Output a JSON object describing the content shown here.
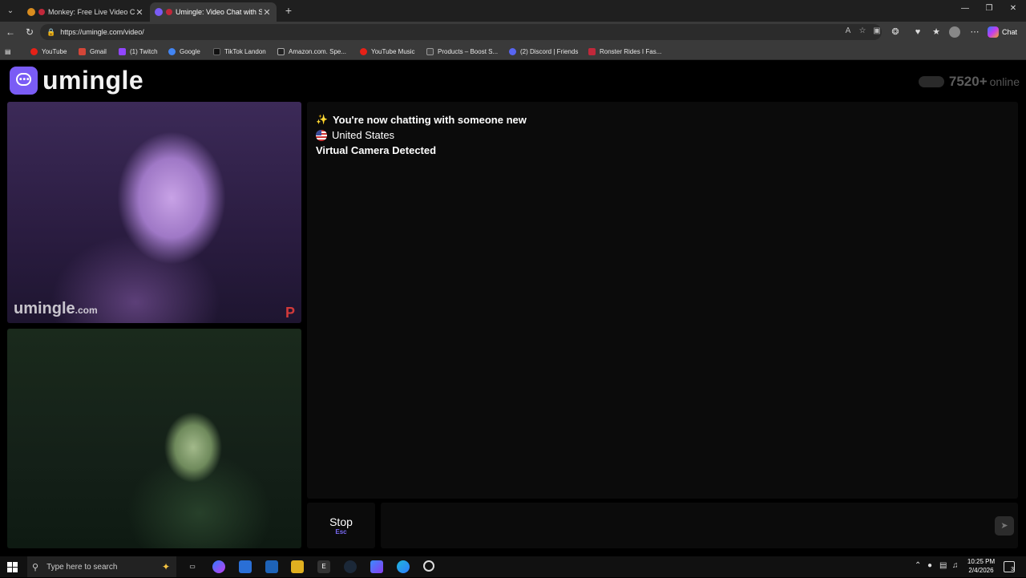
{
  "browser": {
    "tabs": [
      {
        "label": "Monkey: Free Live Video Chat",
        "active": false,
        "favicon_color": "#d98c1f"
      },
      {
        "label": "Umingle: Video Chat with Stra",
        "active": true,
        "favicon_color": "#7a5cf5"
      }
    ],
    "new_tab": "+",
    "url": "https://umingle.com/video/",
    "chat_label": "Chat",
    "bookmarks": [
      {
        "label": "YouTube",
        "icon_color": "#e62117"
      },
      {
        "label": "Gmail",
        "icon_color": "#d44638"
      },
      {
        "label": "(1) Twitch",
        "icon_color": "#9146ff"
      },
      {
        "label": "Google",
        "icon_color": "#4285f4"
      },
      {
        "label": "TikTok Landon",
        "icon_color": "#111111"
      },
      {
        "label": "Amazon.com. Spe...",
        "icon_color": "#222222"
      },
      {
        "label": "YouTube Music",
        "icon_color": "#e62117"
      },
      {
        "label": "Products – Boost S...",
        "icon_color": "#444444"
      },
      {
        "label": "(2) Discord | Friends",
        "icon_color": "#5865f2"
      },
      {
        "label": "Ronster Rides I Fas...",
        "icon_color": "#c0283a"
      }
    ]
  },
  "site": {
    "brand": "umingle",
    "brand_color": "#7a5cf5",
    "online_count": "7520+",
    "online_label": "online",
    "stranger_watermark": "umingle",
    "stranger_watermark_suffix": ".com",
    "stranger_badge": "P"
  },
  "chat": {
    "messages": [
      {
        "icon": "sparkles-icon",
        "text": "You're now chatting with someone new"
      },
      {
        "icon": "us-flag-icon",
        "text": "United States"
      },
      {
        "icon": "",
        "text": "Virtual Camera Detected"
      }
    ],
    "stop_label": "Stop",
    "stop_shortcut": "Esc",
    "input_placeholder": "",
    "send_icon": "send-icon"
  },
  "taskbar": {
    "search_placeholder": "Type here to search",
    "time": "10:25 PM",
    "date": "2/4/2026",
    "notification_count": "3"
  }
}
